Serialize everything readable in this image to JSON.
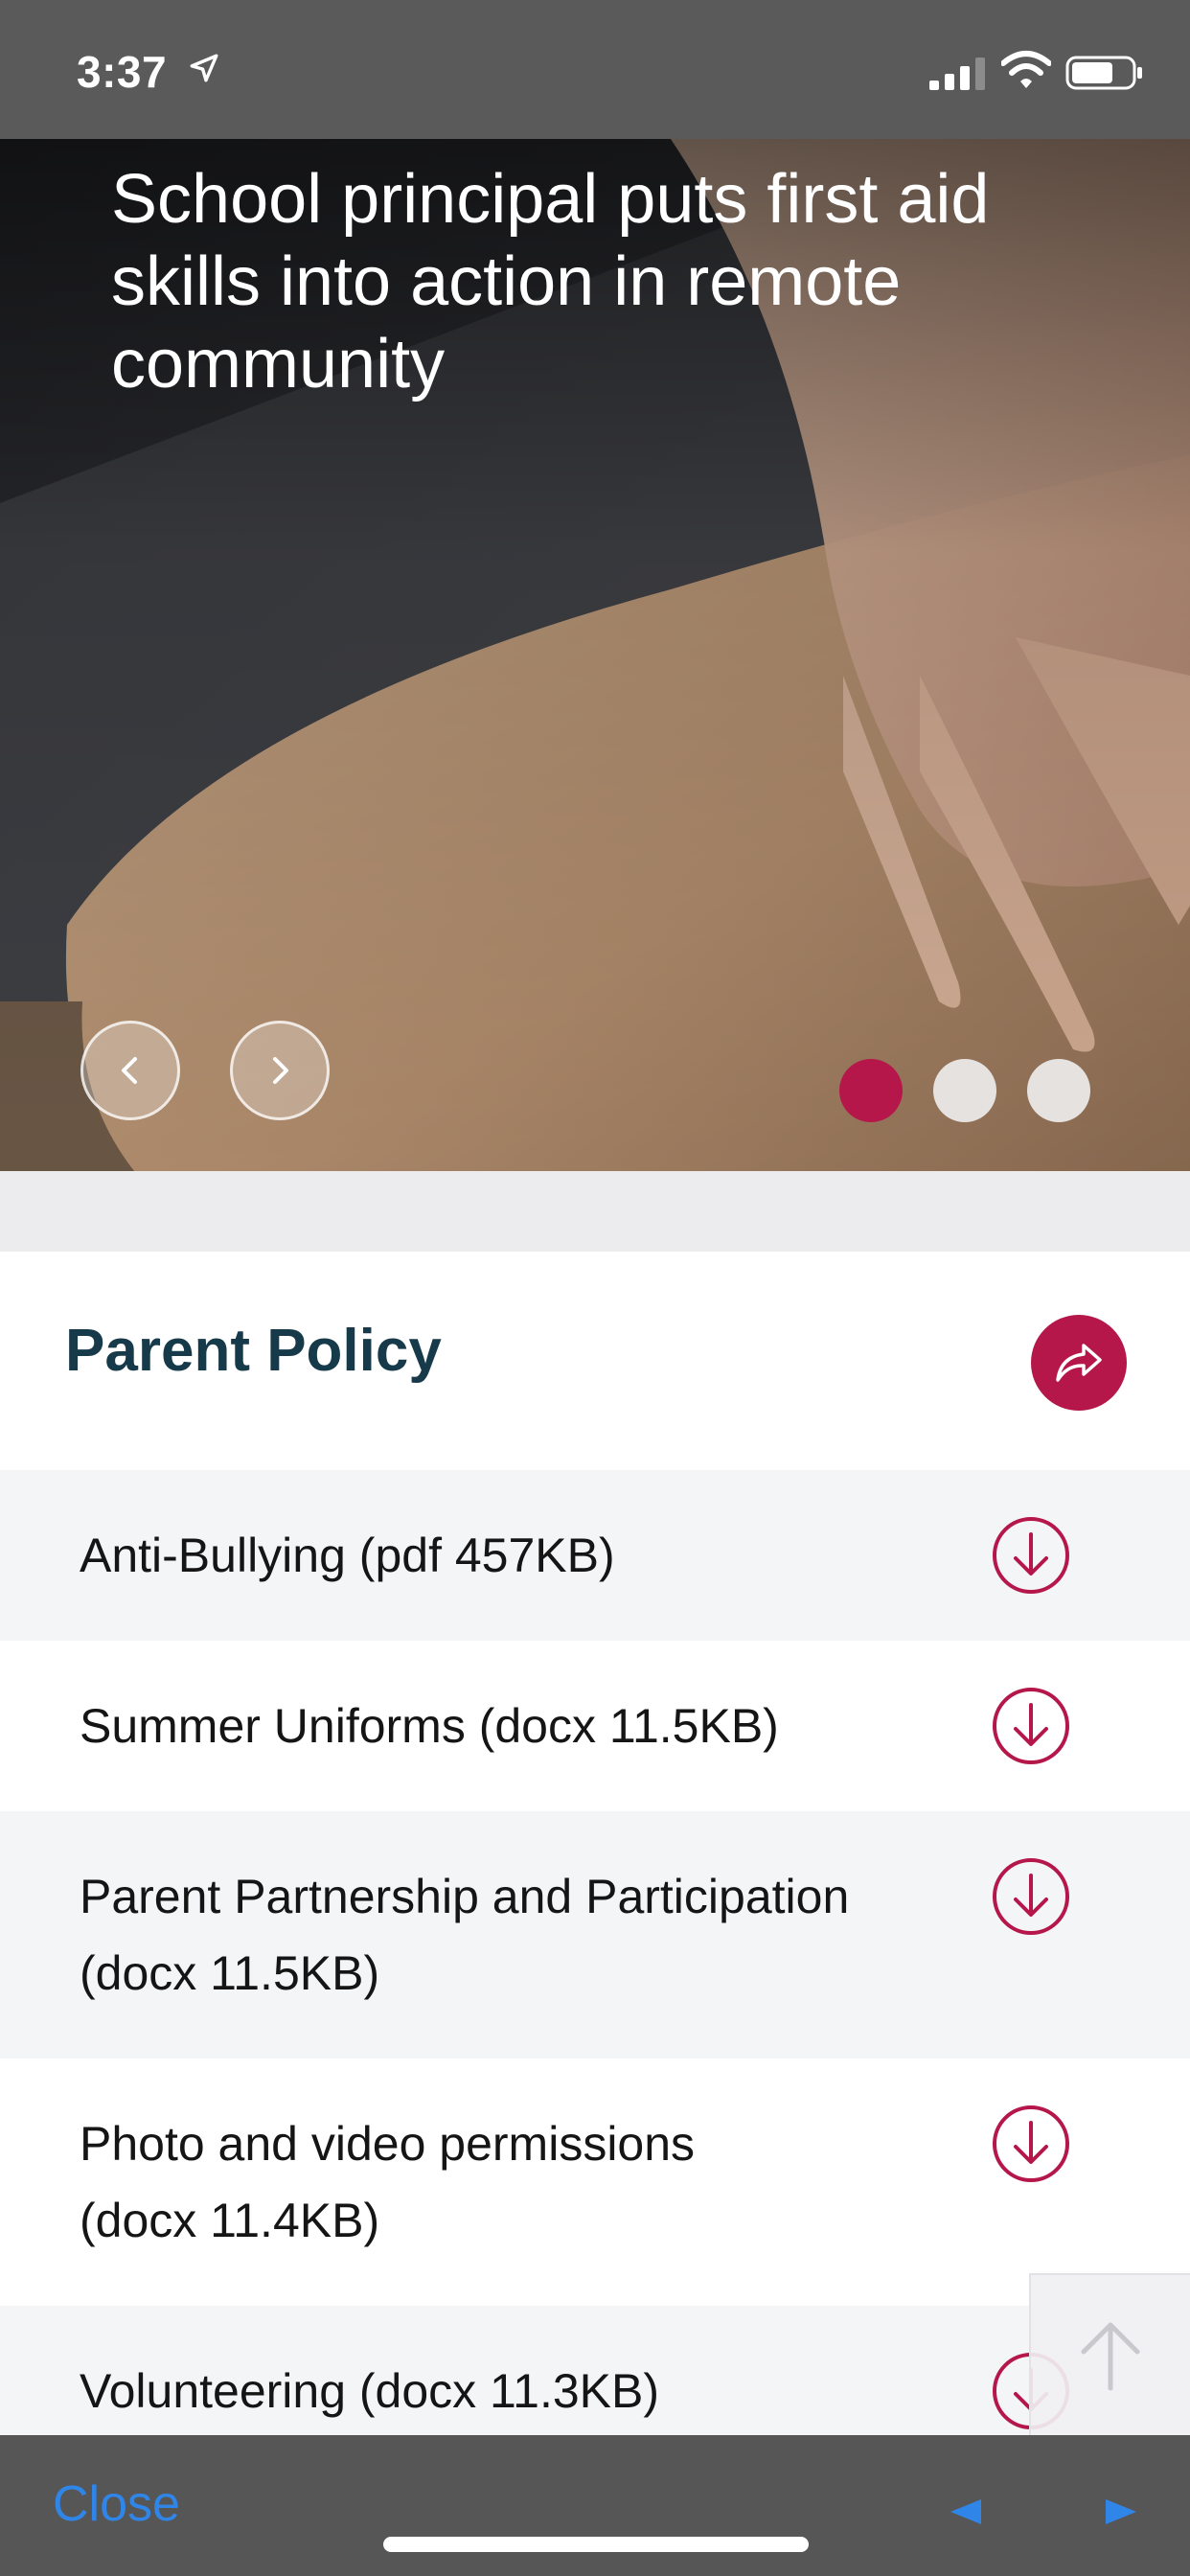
{
  "status_bar": {
    "time": "3:37"
  },
  "hero": {
    "title": "School principal puts first aid skills into action in remote community",
    "slides_total": 3,
    "active_slide": 1,
    "accent_color": "#b5174b"
  },
  "section": {
    "title": "Parent Policy"
  },
  "documents": [
    {
      "label": "Anti-Bullying (pdf 457KB)"
    },
    {
      "label": "Summer Uniforms (docx 11.5KB)"
    },
    {
      "label_line1": "Parent Partnership and Participation",
      "label_line2": "(docx 11.5KB)"
    },
    {
      "label_line1": "Photo and video permissions",
      "label_line2": "(docx 11.4KB)"
    },
    {
      "label": "Volunteering (docx 11.3KB)"
    }
  ],
  "bottom_bar": {
    "close_label": "Close",
    "link_color": "#2f86e8"
  },
  "icons": {
    "status": [
      "location-arrow-icon",
      "signal-icon",
      "wifi-icon",
      "battery-icon"
    ],
    "carousel": [
      "chevron-left-icon",
      "chevron-right-icon"
    ],
    "share": "share-icon",
    "download": "download-circle-icon",
    "scroll": "arrow-up-icon",
    "nav": [
      "triangle-left-icon",
      "triangle-right-icon"
    ]
  }
}
